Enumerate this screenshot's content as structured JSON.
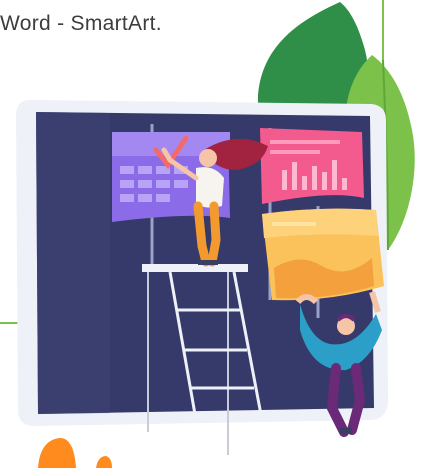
{
  "caption": {
    "text": "Word - SmartArt."
  },
  "colors": {
    "board": "#363a6a",
    "board_frame": "#eef1f8",
    "calendar_card": "#8b6be8",
    "chart_card": "#f35b8e",
    "doc_card": "#fbc15a",
    "leaf_dark": "#2f8f49",
    "leaf_light": "#7bc14a",
    "guide_line": "#7bc14a",
    "accent_orange": "#ff8a1e"
  },
  "icons": [
    "calendar-card",
    "bar-chart-card",
    "document-card",
    "leaf",
    "person-on-platform",
    "person-holding-card",
    "ladder"
  ]
}
